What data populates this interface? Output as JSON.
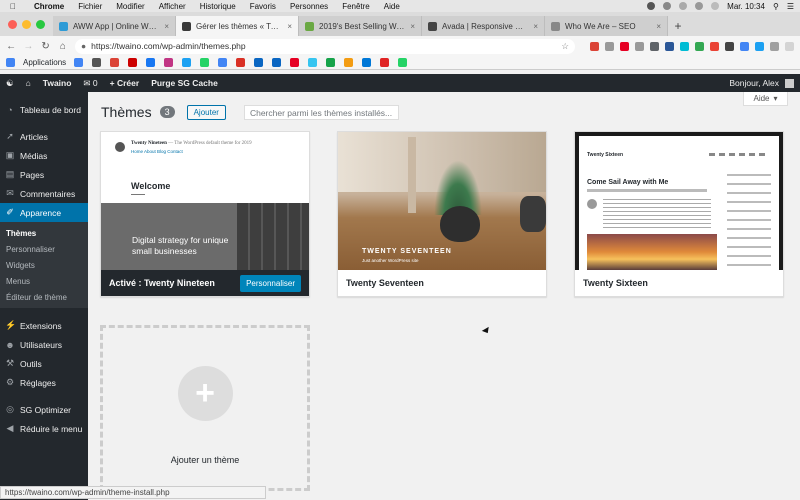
{
  "macos_menubar": {
    "app": "Chrome",
    "menus": [
      "Fichier",
      "Modifier",
      "Afficher",
      "Historique",
      "Favoris",
      "Personnes",
      "Fenêtre",
      "Aide"
    ],
    "clock": "Mar. 10:34"
  },
  "browser": {
    "tabs": [
      {
        "title": "AWW App | Online Whiteboard",
        "favicon_color": "#2e9bd6",
        "active": false
      },
      {
        "title": "Gérer les thèmes « Twaino — WordPress",
        "favicon_color": "#3a3a3a",
        "active": true
      },
      {
        "title": "2019's Best Selling WordPress Themes",
        "favicon_color": "#6aa843",
        "active": false
      },
      {
        "title": "Avada | Responsive Multi-Purpose Theme",
        "favicon_color": "#444",
        "active": false
      },
      {
        "title": "Who We Are – SEO",
        "favicon_color": "#888",
        "active": false
      }
    ],
    "url": "https://twaino.com/wp-admin/themes.php",
    "bookmarks_label": "Applications",
    "bookmark_colors": [
      "#4285f4",
      "#555",
      "#db4437",
      "#cc0000",
      "#1877f2",
      "#c13584",
      "#1da1f2",
      "#25d366",
      "#4285f4",
      "#d93025",
      "#0a66c2",
      "#0a66c2",
      "#e60023",
      "#36c5f0",
      "#16a34a",
      "#f39c12",
      "#0078d7",
      "#e02424",
      "#25d366"
    ],
    "extension_colors": [
      "#db4437",
      "#999",
      "#e60023",
      "#999",
      "#5f6368",
      "#2b5797",
      "#00bcd4",
      "#34a853",
      "#ea4335",
      "#444",
      "#4285f4",
      "#1da1f2",
      "#a0a0a0",
      "#d4d4d4"
    ],
    "status_url": "https://twaino.com/wp-admin/theme-install.php"
  },
  "admin_bar": {
    "site": "Twaino",
    "comments": "0",
    "new": "Créer",
    "purge": "Purge SG Cache",
    "greeting": "Bonjour, Alex"
  },
  "sidebar": {
    "items": [
      {
        "label": "Tableau de bord",
        "icon": "dashboard-icon"
      },
      {
        "label": "Articles",
        "icon": "pin-icon"
      },
      {
        "label": "Médias",
        "icon": "media-icon"
      },
      {
        "label": "Pages",
        "icon": "page-icon"
      },
      {
        "label": "Commentaires",
        "icon": "comment-icon"
      },
      {
        "label": "Apparence",
        "icon": "brush-icon"
      },
      {
        "label": "Extensions",
        "icon": "plugin-icon"
      },
      {
        "label": "Utilisateurs",
        "icon": "users-icon"
      },
      {
        "label": "Outils",
        "icon": "wrench-icon"
      },
      {
        "label": "Réglages",
        "icon": "settings-icon"
      },
      {
        "label": "SG Optimizer",
        "icon": "sg-icon"
      },
      {
        "label": "Réduire le menu",
        "icon": "collapse-icon"
      }
    ],
    "submenu": [
      "Thèmes",
      "Personnaliser",
      "Widgets",
      "Menus",
      "Éditeur de thème"
    ]
  },
  "page": {
    "title": "Thèmes",
    "count": "3",
    "add_label": "Ajouter",
    "search_placeholder": "Chercher parmi les thèmes installés...",
    "help_label": "Aide"
  },
  "themes": [
    {
      "name": "Twenty Nineteen",
      "active_prefix": "Activé :",
      "customize_label": "Personnaliser",
      "preview": {
        "site_title": "Twenty Nineteen",
        "tagline": "— The WordPress default theme for 2019",
        "nav": "Home  About  Blog  Contact",
        "heading": "Welcome",
        "banner": "Digital strategy for unique small businesses"
      }
    },
    {
      "name": "Twenty Seventeen",
      "preview": {
        "wordmark": "TWENTY SEVENTEEN",
        "tagline": "Just another WordPress site"
      }
    },
    {
      "name": "Twenty Sixteen",
      "preview": {
        "site_title": "Twenty Sixteen",
        "heading": "Come Sail Away with Me"
      }
    }
  ],
  "add_theme_label": "Ajouter un thème"
}
